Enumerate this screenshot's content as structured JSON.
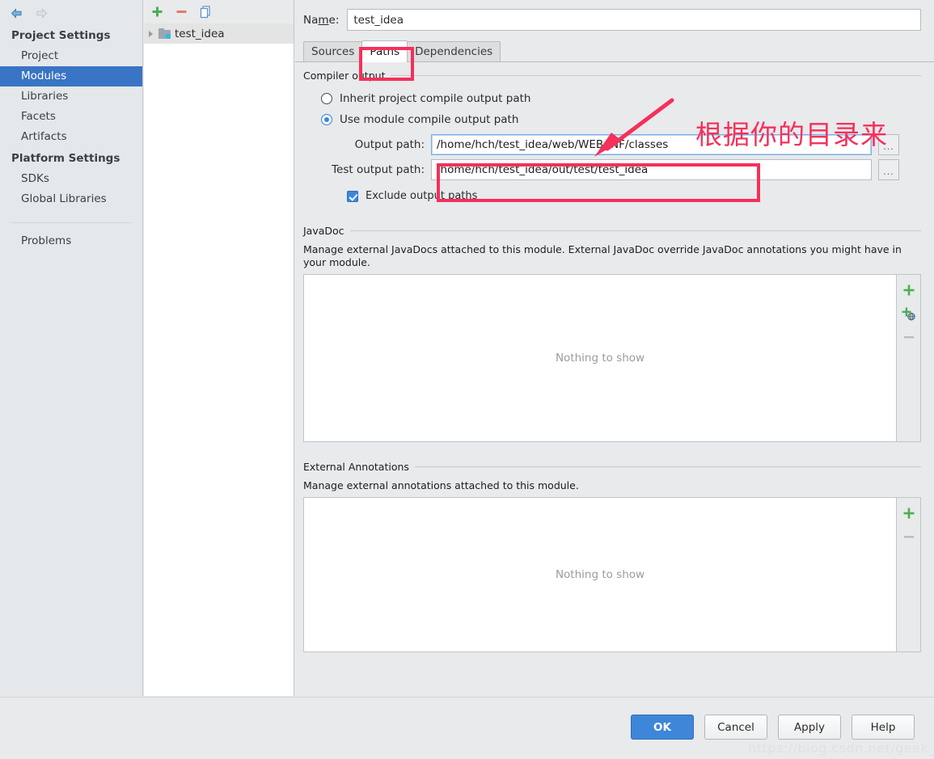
{
  "sidebar": {
    "back_arrow_icon": "arrow-left-icon",
    "forward_arrow_icon": "arrow-right-icon",
    "groups": [
      {
        "title": "Project Settings",
        "items": [
          {
            "label": "Project",
            "selected": false
          },
          {
            "label": "Modules",
            "selected": true
          },
          {
            "label": "Libraries",
            "selected": false
          },
          {
            "label": "Facets",
            "selected": false
          },
          {
            "label": "Artifacts",
            "selected": false
          }
        ]
      },
      {
        "title": "Platform Settings",
        "items": [
          {
            "label": "SDKs",
            "selected": false
          },
          {
            "label": "Global Libraries",
            "selected": false
          }
        ]
      }
    ],
    "problems_label": "Problems"
  },
  "tree": {
    "toolbar": [
      {
        "icon": "plus-icon",
        "title": "Add"
      },
      {
        "icon": "minus-icon",
        "title": "Remove"
      },
      {
        "icon": "copy-icon",
        "title": "Copy"
      }
    ],
    "rows": [
      {
        "label": "test_idea",
        "icon": "module-folder-icon",
        "selected": true,
        "expandable": true
      }
    ]
  },
  "main": {
    "name_label_pre": "Na",
    "name_label_mnemonic": "m",
    "name_label_post": "e:",
    "name_value": "test_idea",
    "tabs": [
      {
        "label": "Sources",
        "active": false
      },
      {
        "label": "Paths",
        "active": true
      },
      {
        "label": "Dependencies",
        "active": false
      }
    ],
    "compiler_output": {
      "title": "Compiler output",
      "radio_inherit_label": "Inherit project compile output path",
      "radio_inherit_selected": false,
      "radio_module_label": "Use module compile output path",
      "radio_module_selected": true,
      "output_path_label": "Output path:",
      "output_path_value": "/home/hch/test_idea/web/WEB-INF/classes",
      "test_output_path_label": "Test output path:",
      "test_output_path_value": "/home/hch/test_idea/out/test/test_idea",
      "browse_label": "...",
      "exclude_label": "Exclude output paths",
      "exclude_checked": true
    },
    "javadoc": {
      "title": "JavaDoc",
      "description": "Manage external JavaDocs attached to this module. External JavaDoc override JavaDoc annotations you might have in your module.",
      "empty_text": "Nothing to show",
      "buttons": [
        {
          "icon": "plus-icon",
          "title": "Add"
        },
        {
          "icon": "plus-globe-icon",
          "title": "Specify JavaDoc URL"
        },
        {
          "icon": "minus-icon",
          "title": "Remove"
        }
      ]
    },
    "external_annotations": {
      "title": "External Annotations",
      "description": "Manage external annotations attached to this module.",
      "empty_text": "Nothing to show",
      "buttons": [
        {
          "icon": "plus-icon",
          "title": "Add"
        },
        {
          "icon": "minus-icon",
          "title": "Remove"
        }
      ]
    }
  },
  "buttons": [
    {
      "label": "OK",
      "primary": true
    },
    {
      "label": "Cancel",
      "primary": false
    },
    {
      "label": "Apply",
      "primary": false
    },
    {
      "label": "Help",
      "primary": false
    }
  ],
  "annotations": {
    "callout_text": "根据你的目录来",
    "accent_color": "#f5305a",
    "arrow_icon": "red-arrow-icon",
    "watermark_text": "https://blog.csdn.net/geek_hch"
  },
  "colors": {
    "selection_blue": "#3a74c4",
    "accent_red": "#f5305a",
    "panel_bg": "#e8eaec",
    "sidebar_bg": "#e4e8eb"
  }
}
